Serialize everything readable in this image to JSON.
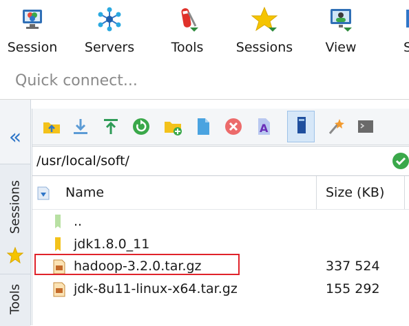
{
  "toolbar": {
    "items": [
      {
        "label": "Session",
        "icon": "session-icon"
      },
      {
        "label": "Servers",
        "icon": "servers-icon"
      },
      {
        "label": "Tools",
        "icon": "tools-icon"
      },
      {
        "label": "Sessions",
        "icon": "sessions-star-icon"
      },
      {
        "label": "View",
        "icon": "view-icon"
      },
      {
        "label": "S",
        "icon": "split-icon"
      }
    ]
  },
  "quick_connect": {
    "placeholder": "Quick connect..."
  },
  "side_tabs": {
    "collapse_icon": "double-chevron-left-icon",
    "sessions_label": "Sessions",
    "tools_label": "Tools"
  },
  "sftp": {
    "path": "/usr/local/soft/",
    "columns": {
      "name": "Name",
      "size": "Size (KB)"
    },
    "rows": [
      {
        "name": "..",
        "size": "",
        "type": "parent-folder"
      },
      {
        "name": "jdk1.8.0_11",
        "size": "",
        "type": "folder"
      },
      {
        "name": "hadoop-3.2.0.tar.gz",
        "size": "337 524",
        "type": "archive"
      },
      {
        "name": "jdk-8u11-linux-x64.tar.gz",
        "size": "155 292",
        "type": "archive"
      }
    ]
  },
  "colors": {
    "accent_blue": "#2f76c8",
    "highlight_red": "#e0222a",
    "ok_green": "#3aa84a",
    "folder_yellow": "#f3c21b"
  }
}
